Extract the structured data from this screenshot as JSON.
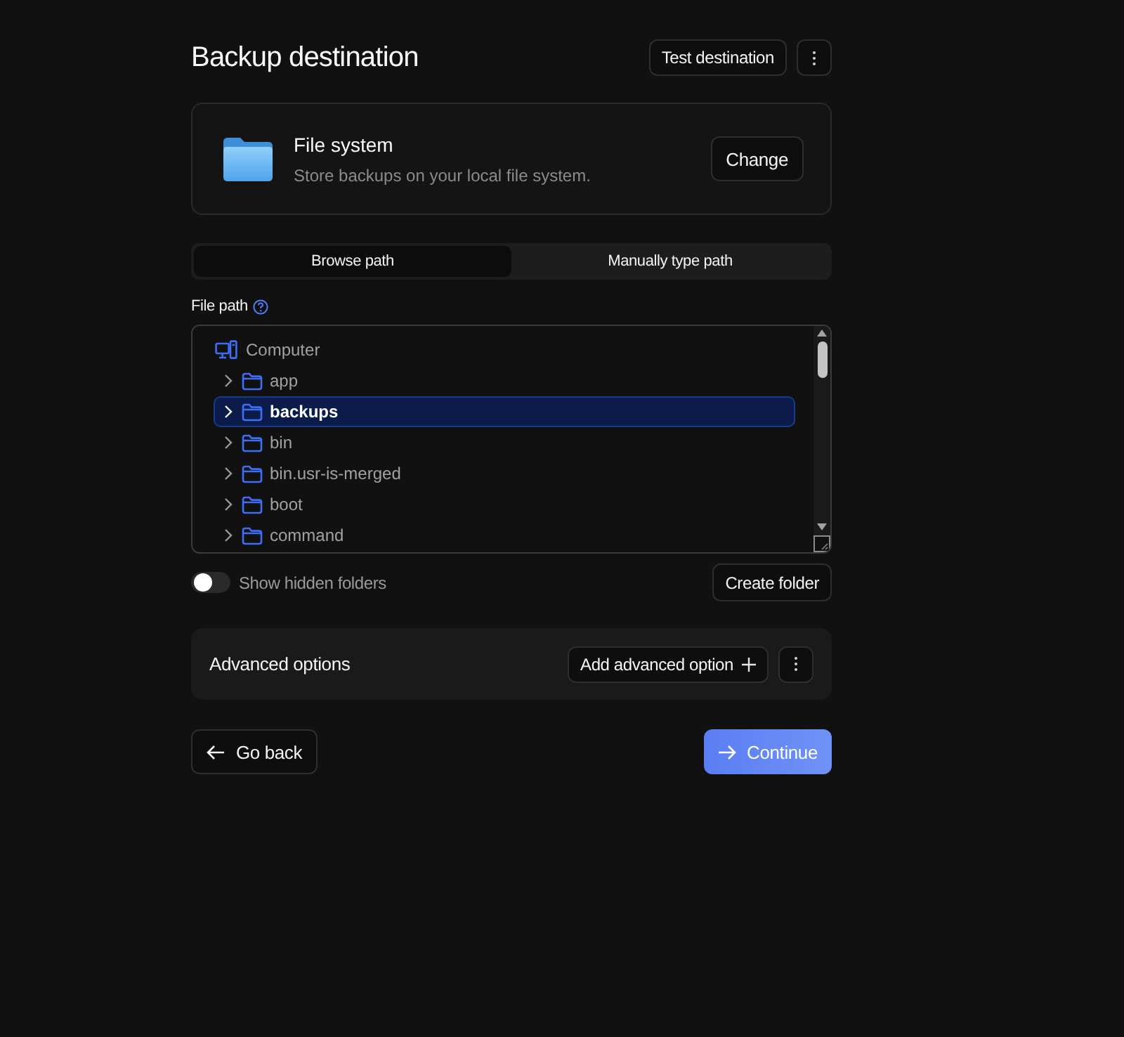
{
  "header": {
    "title": "Backup destination",
    "test_button": "Test destination"
  },
  "destination": {
    "title": "File system",
    "description": "Store backups on your local file system.",
    "change_button": "Change"
  },
  "tabs": [
    {
      "label": "Browse path",
      "selected": true
    },
    {
      "label": "Manually type path",
      "selected": false
    }
  ],
  "file_path": {
    "label": "File path",
    "tree": {
      "label": "Computer",
      "children": [
        {
          "label": "app",
          "expanded": false,
          "selected": false
        },
        {
          "label": "backups",
          "expanded": false,
          "selected": true
        },
        {
          "label": "bin",
          "expanded": false,
          "selected": false
        },
        {
          "label": "bin.usr-is-merged",
          "expanded": false,
          "selected": false
        },
        {
          "label": "boot",
          "expanded": false,
          "selected": false
        },
        {
          "label": "command",
          "expanded": false,
          "selected": false
        }
      ]
    }
  },
  "show_hidden": {
    "label": "Show hidden folders",
    "on": false
  },
  "create_button": "Create folder",
  "advanced": {
    "title": "Advanced options",
    "add_button": "Add advanced option"
  },
  "footer": {
    "back_button": "Go back",
    "continue_button": "Continue"
  }
}
